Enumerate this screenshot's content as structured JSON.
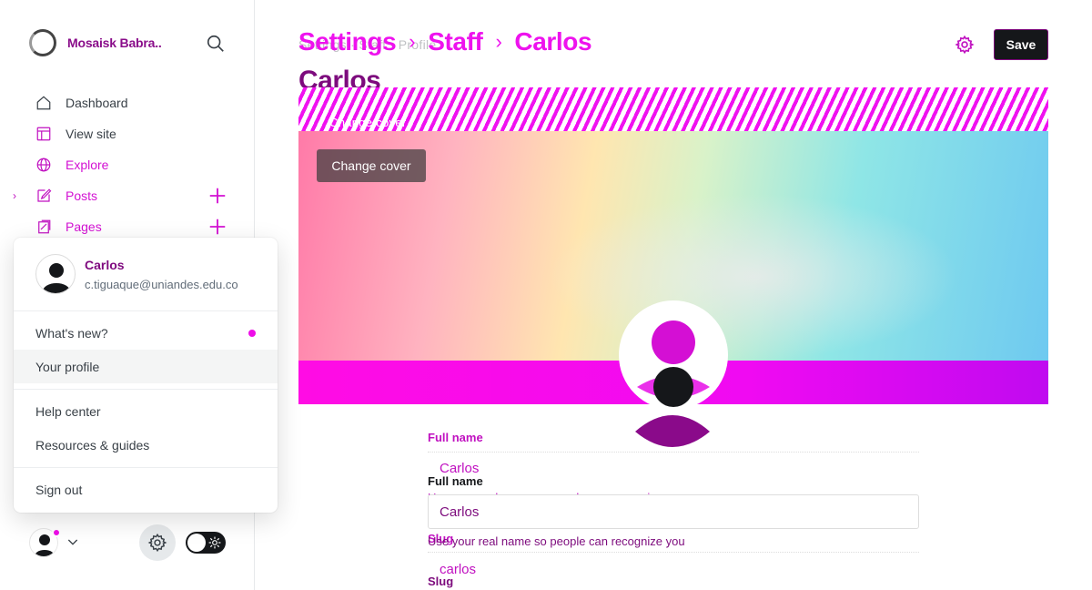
{
  "sidebar": {
    "site_title": "Mosaisk Babra..",
    "search_icon": "search-icon",
    "nav": [
      {
        "label": "Dashboard",
        "icon": "home-icon",
        "color": "#394047"
      },
      {
        "label": "View site",
        "icon": "layout-icon",
        "color": "#394047"
      },
      {
        "label": "Explore",
        "icon": "globe-icon",
        "color": "#d311d3"
      },
      {
        "label": "Posts",
        "icon": "edit-icon",
        "color": "#d311d3",
        "expandable": true,
        "add": true
      },
      {
        "label": "Pages",
        "icon": "pages-icon",
        "color": "#d311d3",
        "add": true
      }
    ]
  },
  "user_menu": {
    "name": "Carlos",
    "email": "c.tiguaque@uniandes.edu.co",
    "items": [
      {
        "label": "What's new?",
        "has_dot": true
      },
      {
        "label": "Your profile",
        "active": true
      },
      {
        "label": "Help center"
      },
      {
        "label": "Resources & guides"
      },
      {
        "label": "Sign out"
      }
    ]
  },
  "header": {
    "breadcrumb": [
      "Settings",
      "Staff",
      "Carlos"
    ],
    "breadcrumb_ghost": "Settings   ·   Staff   ·   Profile",
    "title": "Carlos",
    "save_label": "Save"
  },
  "cover": {
    "change_cover_label": "Change cover",
    "ghost_label": "Change cover"
  },
  "form": {
    "full_name_label": "Full name",
    "full_name_value": "Carlos",
    "full_name_hint": "Use your real name so people can recognize you",
    "slug_label": "Slug",
    "slug_value": "carlos"
  },
  "colors": {
    "accent": "#ee12ee",
    "dark": "#15171a",
    "title": "#7d0b7d"
  }
}
